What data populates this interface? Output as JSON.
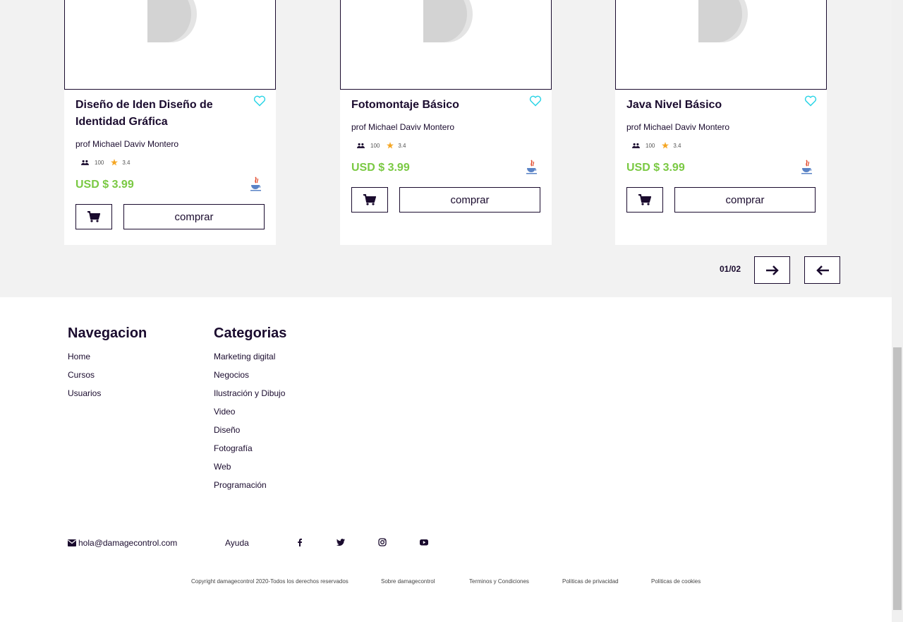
{
  "colors": {
    "accent_price": "#7ac943",
    "brand_dark": "#1a0b2e",
    "heart": "#29d4e6",
    "star": "#f5a623"
  },
  "cards": [
    {
      "title": "Diseño de Iden Diseño de Identidad Gráfica",
      "professor": "prof Michael Daviv Montero",
      "students": "100",
      "rating": "3.4",
      "price": "USD $ 3.99",
      "buy_label": "comprar",
      "icon": "java-icon"
    },
    {
      "title": "Fotomontaje Básico",
      "professor": "prof Michael Daviv Montero",
      "students": "100",
      "rating": "3.4",
      "price": "USD $ 3.99",
      "buy_label": "comprar",
      "icon": "java-icon"
    },
    {
      "title": "Java Nivel Básico",
      "professor": "prof Michael Daviv Montero",
      "students": "100",
      "rating": "3.4",
      "price": "USD $ 3.99",
      "buy_label": "comprar",
      "icon": "java-icon"
    }
  ],
  "pager": {
    "count": "01/02"
  },
  "footer": {
    "nav_title": "Navegacion",
    "nav_items": [
      "Home",
      "Cursos",
      "Usuarios"
    ],
    "cat_title": "Categorias",
    "cat_items": [
      "Marketing digital",
      "Negocios",
      "Ilustración y Dibujo",
      "Video",
      "Diseño",
      "Fotografía",
      "Web",
      "Programación"
    ],
    "email": "hola@damagecontrol.com",
    "help": "Ayuda",
    "social": [
      "facebook-icon",
      "twitter-icon",
      "instagram-icon",
      "youtube-icon"
    ],
    "legal": [
      "Copyright damagecontrol 2020-Todos los derechos reservados",
      "Sobre damagecontrol",
      "Terminos y Condiciones",
      "Politicas de privacidad",
      "Politicas de cookies"
    ]
  }
}
